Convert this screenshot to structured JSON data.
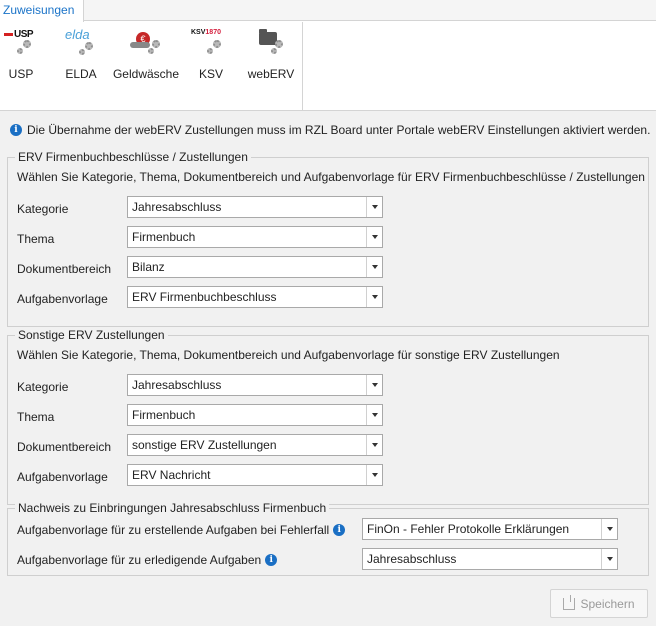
{
  "ribbon": {
    "tab_label": "Zuweisungen",
    "buttons": [
      {
        "label": "USP",
        "icon": "usp-logo-icon",
        "logo_text": "USP"
      },
      {
        "label": "ELDA",
        "icon": "elda-logo-icon",
        "logo_text": "elda"
      },
      {
        "label": "Geldwäsche",
        "icon": "money-laundering-icon"
      },
      {
        "label": "KSV",
        "icon": "ksv-logo-icon",
        "logo_text_a": "KSV",
        "logo_text_b": "1870"
      },
      {
        "label": "webERV",
        "icon": "folder-icon"
      }
    ]
  },
  "info": {
    "text": "Die Übernahme der webERV Zustellungen muss im RZL Board unter Portale webERV Einstellungen aktiviert werden."
  },
  "section1": {
    "legend": "ERV Firmenbuchbeschlüsse / Zustellungen",
    "description": "Wählen Sie Kategorie, Thema, Dokumentbereich und Aufgabenvorlage für ERV Firmenbuchbeschlüsse / Zustellungen",
    "rows": [
      {
        "label": "Kategorie",
        "value": "Jahresabschluss"
      },
      {
        "label": "Thema",
        "value": "Firmenbuch"
      },
      {
        "label": "Dokumentbereich",
        "value": "Bilanz"
      },
      {
        "label": "Aufgabenvorlage",
        "value": "ERV Firmenbuchbeschluss"
      }
    ]
  },
  "section2": {
    "legend": "Sonstige ERV Zustellungen",
    "description": "Wählen Sie Kategorie, Thema, Dokumentbereich und Aufgabenvorlage für sonstige ERV Zustellungen",
    "rows": [
      {
        "label": "Kategorie",
        "value": "Jahresabschluss"
      },
      {
        "label": "Thema",
        "value": "Firmenbuch"
      },
      {
        "label": "Dokumentbereich",
        "value": "sonstige ERV Zustellungen"
      },
      {
        "label": "Aufgabenvorlage",
        "value": "ERV Nachricht"
      }
    ]
  },
  "section3": {
    "legend": "Nachweis zu Einbringungen Jahresabschluss Firmenbuch",
    "rows": [
      {
        "label": "Aufgabenvorlage für zu erstellende Aufgaben bei Fehlerfall",
        "value": "FinOn - Fehler Protokolle Erklärungen"
      },
      {
        "label": "Aufgabenvorlage für zu erledigende Aufgaben",
        "value": "Jahresabschluss"
      }
    ]
  },
  "footer": {
    "save_label": "Speichern"
  },
  "colors": {
    "accent": "#1a73c8",
    "info_icon": "#1a6fc4",
    "background": "#f1f1f1"
  }
}
